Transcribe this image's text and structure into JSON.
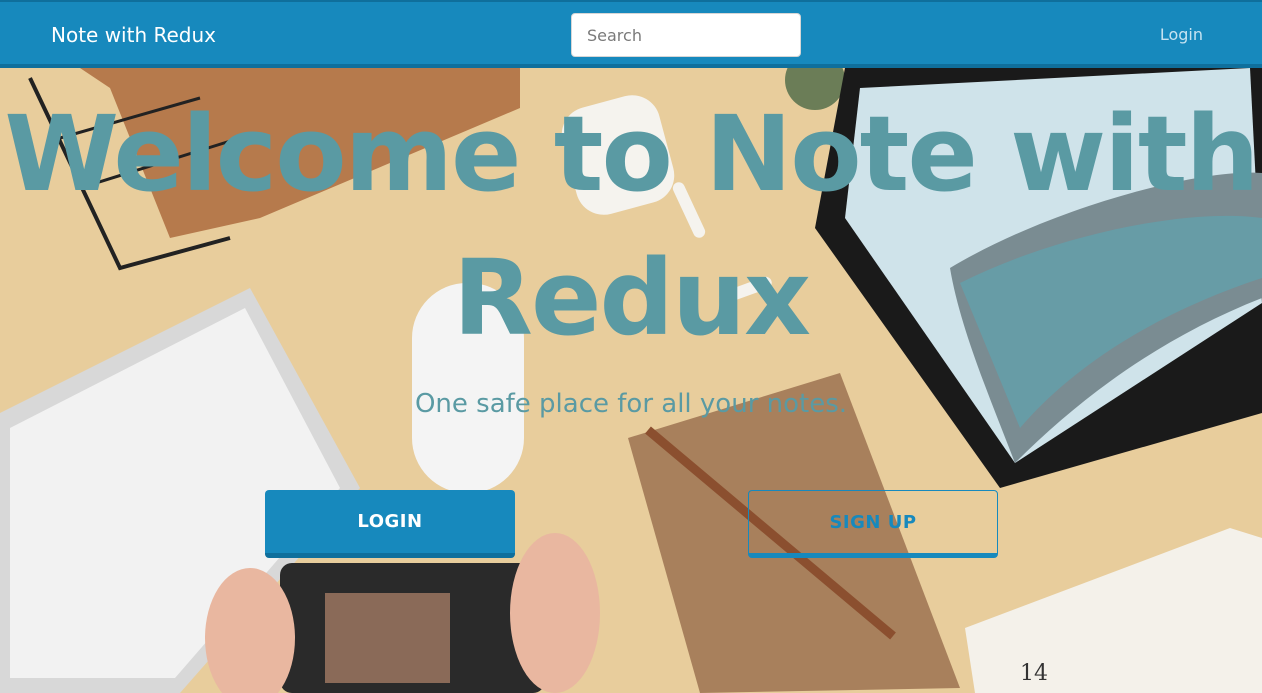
{
  "navbar": {
    "brand": "Note with Redux",
    "search_placeholder": "Search",
    "login_link": "Login"
  },
  "hero": {
    "title_line1": "Welcome to Note with",
    "title_line2": "Redux",
    "subtitle": "One safe place for all your notes.",
    "login_button": "LOGIN",
    "signup_button": "SIGN UP"
  },
  "colors": {
    "primary": "#1789bd",
    "hero_text": "#5a9aa3",
    "desk_background": "#e9cf9f"
  },
  "background_photo": {
    "notebook_date": "14"
  }
}
